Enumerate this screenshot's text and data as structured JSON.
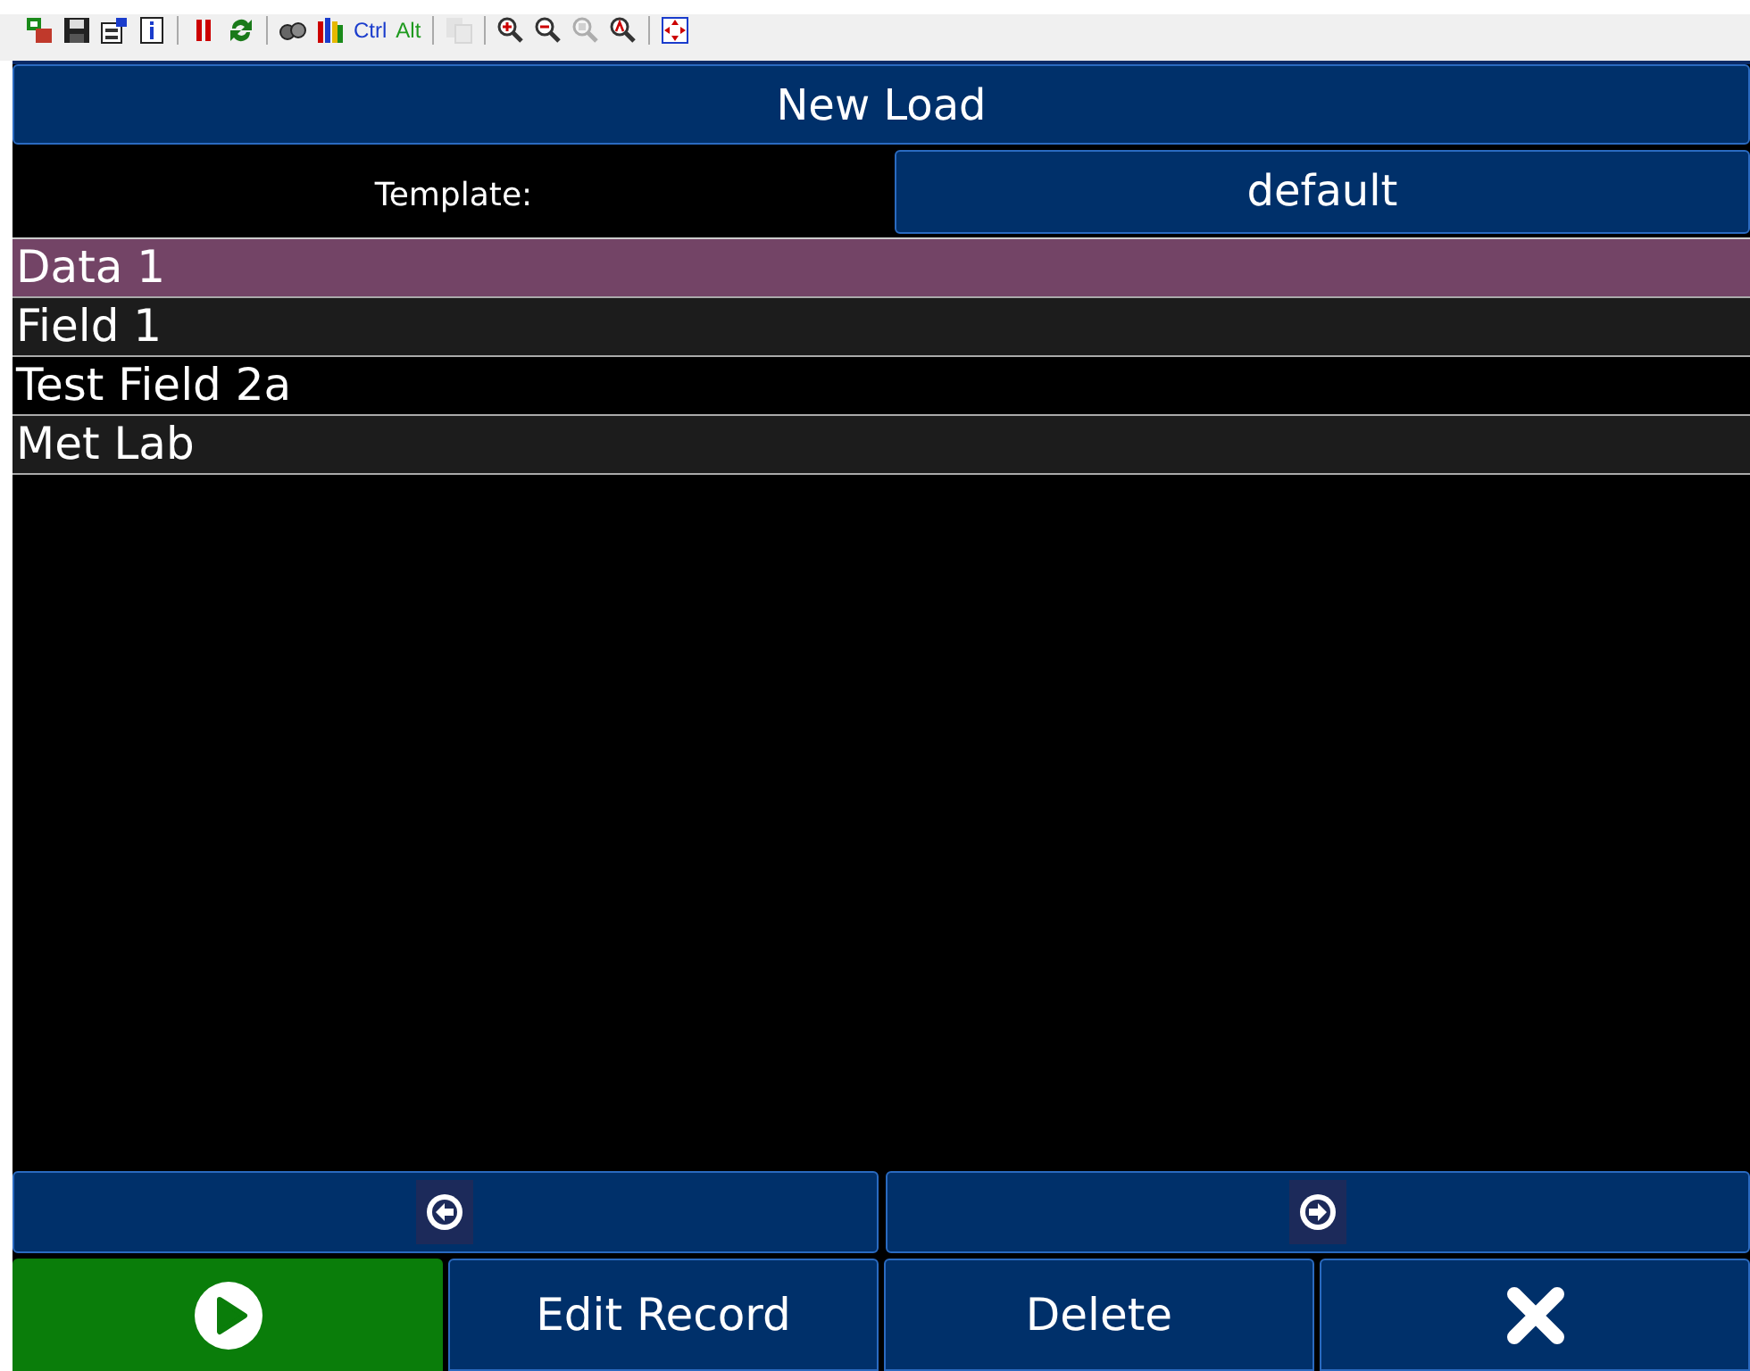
{
  "toolbar": [
    {
      "kind": "icon",
      "disabled": false
    },
    {
      "kind": "icon",
      "disabled": false
    },
    {
      "kind": "icon",
      "disabled": false
    },
    {
      "kind": "icon",
      "disabled": false
    },
    {
      "kind": "separator"
    },
    {
      "kind": "icon",
      "disabled": false
    },
    {
      "kind": "icon",
      "disabled": false
    },
    {
      "kind": "separator"
    },
    {
      "kind": "icon",
      "disabled": false
    },
    {
      "kind": "icon",
      "disabled": false
    },
    {
      "kind": "text",
      "label": "Ctrl",
      "color": "#1a3ccc"
    },
    {
      "kind": "text",
      "label": "Alt",
      "color": "#1e9a1e"
    },
    {
      "kind": "separator"
    },
    {
      "kind": "icon",
      "disabled": true
    },
    {
      "kind": "separator"
    },
    {
      "kind": "icon",
      "disabled": false
    },
    {
      "kind": "icon",
      "disabled": false
    },
    {
      "kind": "icon",
      "disabled": true
    },
    {
      "kind": "icon",
      "disabled": false
    },
    {
      "kind": "separator"
    },
    {
      "kind": "icon",
      "disabled": false
    }
  ],
  "title": "New Load",
  "template": {
    "label": "Template:",
    "value": "default"
  },
  "records": [
    {
      "name": "Data 1",
      "selected": true
    },
    {
      "name": "Field 1",
      "selected": false
    },
    {
      "name": "Test Field 2a",
      "selected": false
    },
    {
      "name": "Met Lab",
      "selected": false
    }
  ],
  "buttons": [
    {
      "kind": "play"
    },
    {
      "kind": "text",
      "label": "Edit Record"
    },
    {
      "kind": "text",
      "label": "Delete"
    },
    {
      "kind": "close"
    }
  ]
}
